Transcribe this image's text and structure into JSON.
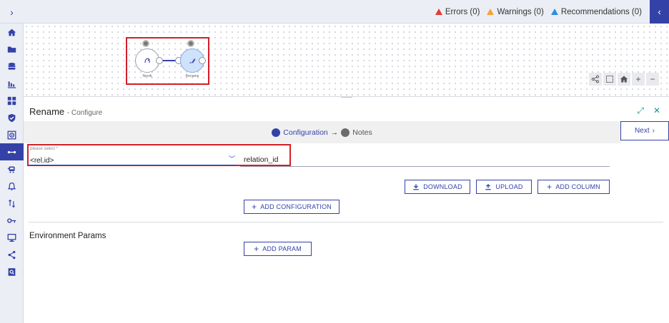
{
  "topbar": {
    "expand_icon": "chevron-right-icon",
    "errors": "Errors (0)",
    "warnings": "Warnings (0)",
    "recommendations": "Recommendations (0)",
    "collapse_icon": "chevron-left-icon",
    "colors": {
      "error": "#e53935",
      "warning": "#f2a33a",
      "recommendation": "#2f8fd8",
      "accent": "#3442a8"
    }
  },
  "sidebar": {
    "items": [
      {
        "icon": "home-icon",
        "active": false
      },
      {
        "icon": "folder-icon",
        "active": false
      },
      {
        "icon": "database-icon",
        "active": false
      },
      {
        "icon": "bar-chart-icon",
        "active": false
      },
      {
        "icon": "dashboard-icon",
        "active": false
      },
      {
        "icon": "shield-check-icon",
        "active": false
      },
      {
        "icon": "target-icon",
        "active": false
      },
      {
        "icon": "pipeline-icon",
        "active": true
      },
      {
        "icon": "train-icon",
        "active": false
      },
      {
        "icon": "bell-icon",
        "active": false
      },
      {
        "icon": "transfer-icon",
        "active": false
      },
      {
        "icon": "key-icon",
        "active": false
      },
      {
        "icon": "monitor-icon",
        "active": false
      },
      {
        "icon": "share-icon",
        "active": false
      },
      {
        "icon": "search-doc-icon",
        "active": false
      }
    ]
  },
  "flow": {
    "nodes": [
      {
        "label": "Neo4j",
        "icon": "neo4j-icon"
      },
      {
        "label": "Rename",
        "icon": "rename-icon"
      }
    ]
  },
  "panel": {
    "title": "Rename",
    "subtitle": "- Configure",
    "steps": [
      {
        "label": "Configuration"
      },
      {
        "label": "Notes"
      }
    ],
    "arrow": "→",
    "next_label": "Next",
    "select_label": "please select *",
    "select_value": "<rel.id>",
    "field_value": "relation_id",
    "download_label": "DOWNLOAD",
    "upload_label": "UPLOAD",
    "add_column_label": "ADD COLUMN",
    "add_configuration_label": "ADD CONFIGURATION",
    "env_title": "Environment Params",
    "add_param_label": "ADD PARAM"
  }
}
